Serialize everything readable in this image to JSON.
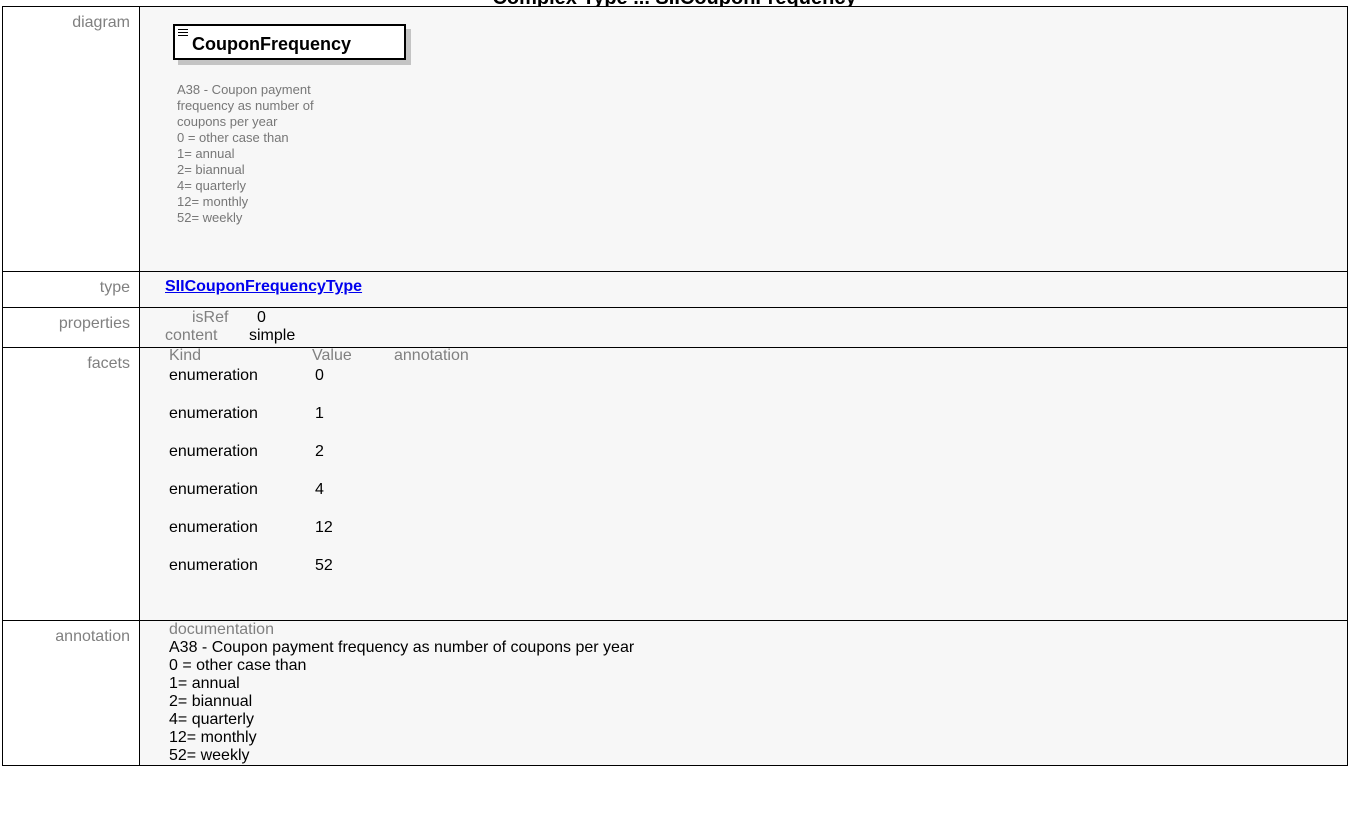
{
  "heading": "...type ... ... ... ... ... ... ... ...CouponFrequency",
  "rows": {
    "diagram": {
      "label": "diagram",
      "element_name": "CouponFrequency",
      "element_doc": "A38 - Coupon payment\nfrequency as number of\ncoupons per year\n0 = other case than\n1= annual\n2= biannual\n4= quarterly\n12= monthly\n52= weekly"
    },
    "type": {
      "label": "type",
      "link_text": "SIICouponFrequencyType"
    },
    "properties": {
      "label": "properties",
      "items": [
        {
          "key": "isRef",
          "value": "0"
        },
        {
          "key": "content",
          "value": "simple"
        }
      ]
    },
    "facets": {
      "label": "facets",
      "headers": [
        "Kind",
        "Value",
        "annotation"
      ],
      "items": [
        {
          "kind": "enumeration",
          "value": "0"
        },
        {
          "kind": "enumeration",
          "value": "1"
        },
        {
          "kind": "enumeration",
          "value": "2"
        },
        {
          "kind": "enumeration",
          "value": "4"
        },
        {
          "kind": "enumeration",
          "value": "12"
        },
        {
          "kind": "enumeration",
          "value": "52"
        }
      ]
    },
    "annotation": {
      "label": "annotation",
      "doc_key": "documentation",
      "doc_text": "A38 - Coupon payment frequency as number of coupons per year\n0 = other case than\n1= annual\n2= biannual\n4= quarterly\n12= monthly\n52= weekly"
    }
  }
}
